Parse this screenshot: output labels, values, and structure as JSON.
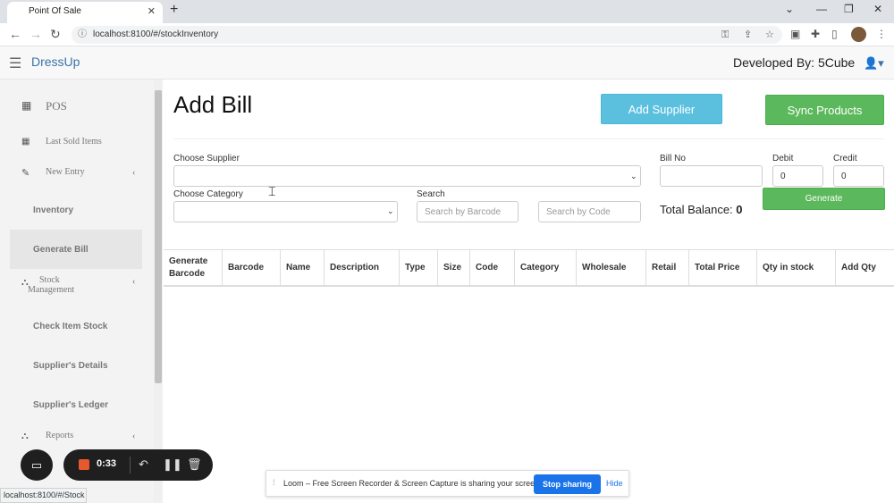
{
  "browser": {
    "tab_title": "Point Of Sale",
    "tab_close": "✕",
    "new_tab": "+",
    "url": "localhost:8100/#/stockInventory",
    "status_url": "localhost:8100/#/Stock"
  },
  "header": {
    "brand": "DressUp",
    "developed_by": "Developed By: 5Cube"
  },
  "sidebar": {
    "pos": "POS",
    "last_sold": "Last Sold Items",
    "new_entry": "New Entry",
    "inventory": "Inventory",
    "generate_bill": "Generate Bill",
    "stock_management_1": "Stock",
    "stock_management_2": "Management",
    "check_item_stock": "Check Item Stock",
    "suppliers_details": "Supplier's Details",
    "suppliers_ledger": "Supplier's Ledger",
    "reports": "Reports"
  },
  "main": {
    "title": "Add Bill",
    "add_supplier": "Add Supplier",
    "sync_products": "Sync Products",
    "choose_supplier": "Choose Supplier",
    "choose_category": "Choose Category",
    "search_label": "Search",
    "search_barcode_placeholder": "Search by Barcode",
    "search_code_placeholder": "Search by Code",
    "bill_no_label": "Bill No",
    "debit_label": "Debit",
    "debit_value": "0",
    "credit_label": "Credit",
    "credit_value": "0",
    "generate": "Generate",
    "total_balance_label": "Total Balance:",
    "total_balance_value": "0"
  },
  "table": {
    "headers": [
      "Generate Barcode",
      "Barcode",
      "Name",
      "Description",
      "Type",
      "Size",
      "Code",
      "Category",
      "Wholesale",
      "Retail",
      "Total Price",
      "Qty in stock",
      "Add Qty"
    ]
  },
  "loom": {
    "time": "0:33"
  },
  "share": {
    "message": "Loom – Free Screen Recorder & Screen Capture is sharing your screen.",
    "stop": "Stop sharing",
    "hide": "Hide"
  },
  "colors": {
    "brand": "#3a73a8",
    "info_button": "#5bc0de",
    "success_button": "#5cb85c",
    "share_button": "#1a73e8",
    "record": "#e8582e"
  }
}
